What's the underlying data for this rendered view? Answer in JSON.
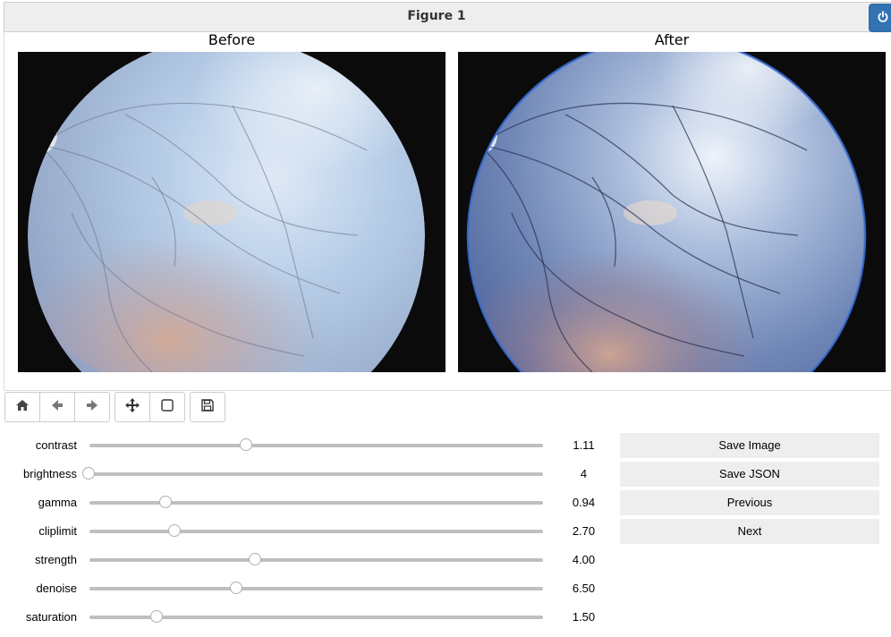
{
  "figure": {
    "title": "Figure 1",
    "accent_color": "#3373b3"
  },
  "panels": [
    {
      "title": "Before"
    },
    {
      "title": "After"
    }
  ],
  "toolbar": {
    "tools": [
      {
        "name": "home-icon"
      },
      {
        "name": "back-arrow-icon"
      },
      {
        "name": "forward-arrow-icon"
      },
      {
        "name": "pan-move-icon"
      },
      {
        "name": "zoom-rectangle-icon"
      },
      {
        "name": "save-disk-icon"
      }
    ]
  },
  "sliders": [
    {
      "label": "contrast",
      "value": "1.11",
      "level": 0.347
    },
    {
      "label": "brightness",
      "value": "4",
      "level": 0.0
    },
    {
      "label": "gamma",
      "value": "0.94",
      "level": 0.169
    },
    {
      "label": "cliplimit",
      "value": "2.70",
      "level": 0.19
    },
    {
      "label": "strength",
      "value": "4.00",
      "level": 0.367
    },
    {
      "label": "denoise",
      "value": "6.50",
      "level": 0.325
    },
    {
      "label": "saturation",
      "value": "1.50",
      "level": 0.15
    }
  ],
  "buttons": {
    "save_image": "Save Image",
    "save_json": "Save JSON",
    "previous": "Previous",
    "next": "Next"
  }
}
